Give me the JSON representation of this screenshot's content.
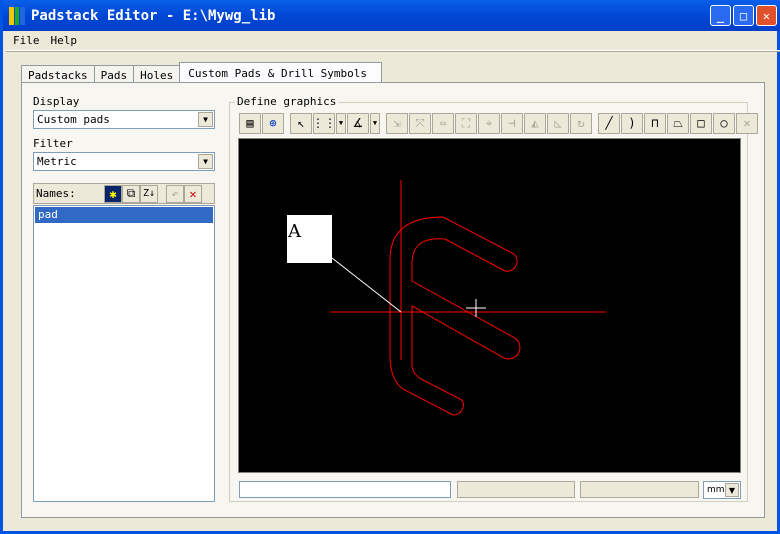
{
  "window": {
    "title": "Padstack Editor - E:\\Mywg_lib",
    "min": "_",
    "max": "□",
    "close": "✕"
  },
  "menu": [
    "File",
    "Help"
  ],
  "tabs": [
    {
      "label": "Padstacks"
    },
    {
      "label": "Pads"
    },
    {
      "label": "Holes"
    },
    {
      "label": "Custom Pads & Drill Symbols",
      "active": true
    }
  ],
  "display": {
    "label": "Display",
    "value": "Custom pads"
  },
  "filter": {
    "label": "Filter",
    "value": "Metric"
  },
  "names": {
    "label": "Names:",
    "items": [
      "pad"
    ]
  },
  "graphics": {
    "label": "Define graphics",
    "marker_text": "A"
  },
  "status": {
    "input": "",
    "units": "mm"
  },
  "colors": {
    "canvas": "#000000",
    "shape": "#ff0000",
    "selection": "#316ac5"
  }
}
